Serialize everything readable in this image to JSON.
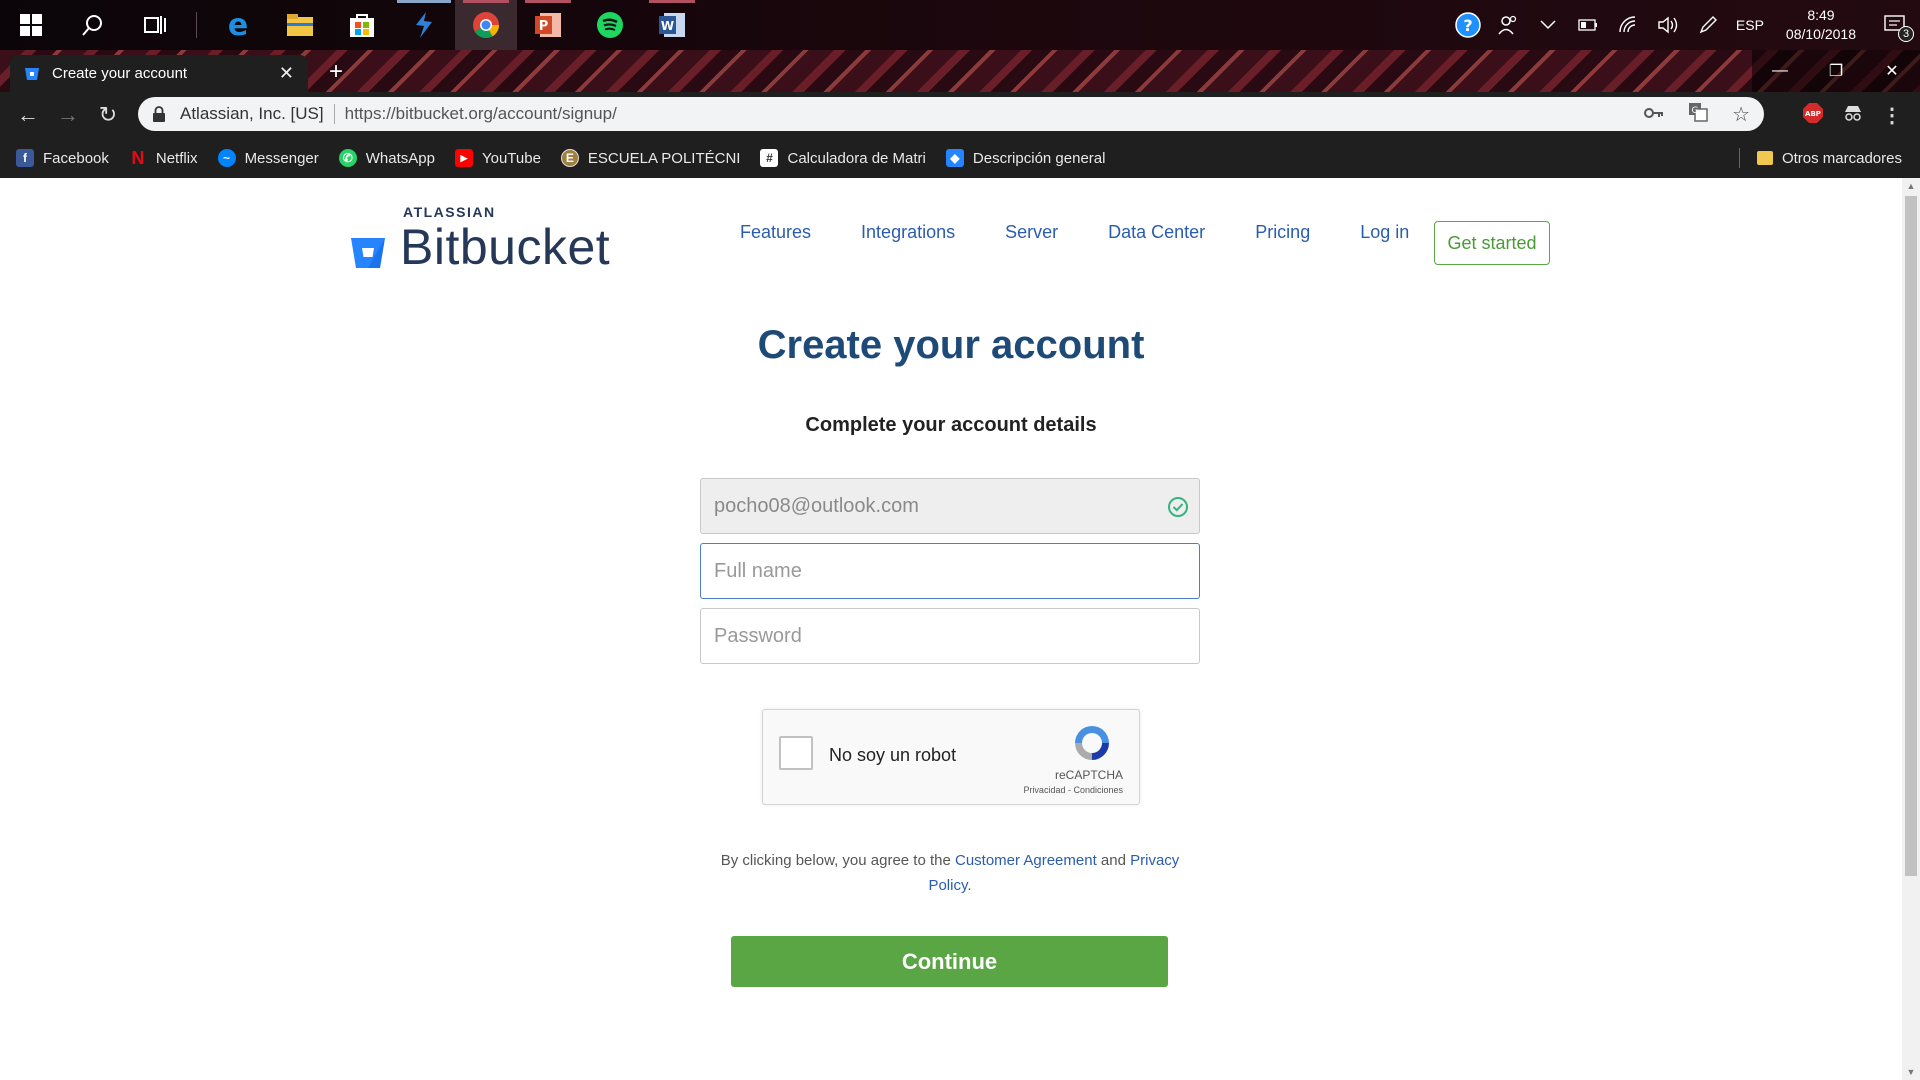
{
  "taskbar": {
    "apps": [
      {
        "icon": "windows-start-icon"
      },
      {
        "icon": "search-icon"
      },
      {
        "icon": "task-view-icon"
      },
      {
        "icon": "edge-icon"
      },
      {
        "icon": "file-explorer-icon"
      },
      {
        "icon": "store-icon"
      },
      {
        "icon": "app-icon"
      },
      {
        "icon": "chrome-icon"
      },
      {
        "icon": "powerpoint-icon"
      },
      {
        "icon": "spotify-icon"
      },
      {
        "icon": "word-icon"
      }
    ],
    "tray": {
      "language": "ESP",
      "time": "8:49",
      "date": "08/10/2018",
      "notification_count": "3"
    }
  },
  "browser": {
    "tab": {
      "title": "Create your account"
    },
    "address": {
      "org": "Atlassian, Inc. [US]",
      "url": "https://bitbucket.org/account/signup/"
    },
    "bookmarks": [
      {
        "label": "Facebook",
        "color": "#3b5998",
        "glyph": "f"
      },
      {
        "label": "Netflix",
        "color": "#e50914",
        "glyph": "N"
      },
      {
        "label": "Messenger",
        "color": "#0084ff",
        "glyph": "~"
      },
      {
        "label": "WhatsApp",
        "color": "#25d366",
        "glyph": "w"
      },
      {
        "label": "YouTube",
        "color": "#ff0000",
        "glyph": "▶"
      },
      {
        "label": "ESCUELA POLITÉCNI",
        "color": "#a08040",
        "glyph": "E"
      },
      {
        "label": "Calculadora de Matri",
        "color": "#ffffff",
        "glyph": "#"
      },
      {
        "label": "Descripción general",
        "color": "#2684ff",
        "glyph": "◆"
      }
    ],
    "other_bookmarks": "Otros marcadores"
  },
  "page": {
    "brand": {
      "company": "ATLASSIAN",
      "product": "Bitbucket"
    },
    "nav": [
      "Features",
      "Integrations",
      "Server",
      "Data Center",
      "Pricing",
      "Log in"
    ],
    "cta": "Get started",
    "title": "Create your account",
    "subtitle": "Complete your account details",
    "form": {
      "email_value": "pocho08@outlook.com",
      "fullname_placeholder": "Full name",
      "password_placeholder": "Password"
    },
    "recaptcha": {
      "label": "No soy un robot",
      "brand": "reCAPTCHA",
      "links": "Privacidad - Condiciones"
    },
    "agreement": {
      "prefix": "By clicking below, you agree to the ",
      "customer_agreement": "Customer Agreement",
      "and": " and ",
      "privacy_policy": "Privacy Policy",
      "suffix": "."
    },
    "submit": "Continue"
  },
  "colors": {
    "brand_blue": "#2684ff",
    "heading_blue": "#1e4a78",
    "link_blue": "#2a5dae",
    "cta_green": "#5aa544"
  }
}
